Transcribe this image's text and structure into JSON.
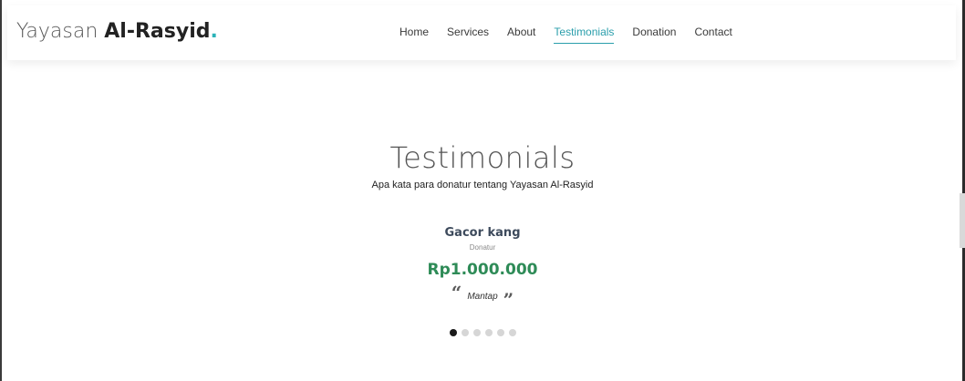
{
  "brand": {
    "light": "Yayasan ",
    "bold": "Al-Rasyid",
    "dot": ".",
    "accent_color": "#2bb3b8"
  },
  "nav": {
    "items": [
      {
        "label": "Home"
      },
      {
        "label": "Services"
      },
      {
        "label": "About"
      },
      {
        "label": "Testimonials"
      },
      {
        "label": "Donation"
      },
      {
        "label": "Contact"
      }
    ],
    "active": "Testimonials",
    "active_color": "#2a9eab"
  },
  "section": {
    "title": "Testimonials",
    "subtitle": "Apa kata para donatur tentang Yayasan Al-Rasyid"
  },
  "testimonial": {
    "name": "Gacor kang",
    "role": "Donatur",
    "amount": "Rp1.000.000",
    "amount_color": "#2e8b57",
    "quote_open": "“",
    "quote": "Mantap",
    "quote_close": "”"
  },
  "carousel": {
    "total": 6,
    "active_index": 0
  }
}
